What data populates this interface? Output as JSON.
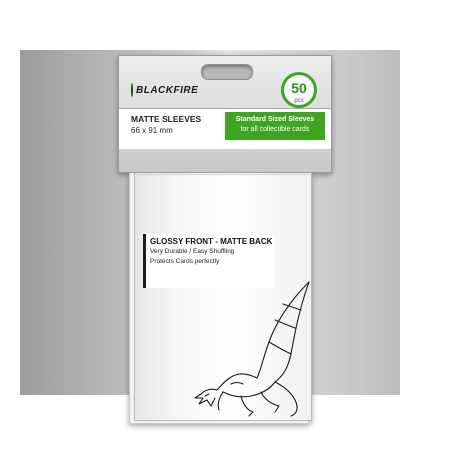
{
  "brand": {
    "name": "BLACKFIRE"
  },
  "badge": {
    "count": "50",
    "unit": "pcs"
  },
  "header": {
    "sleeve_type": "MATTE SLEEVES",
    "sleeve_size": "66 x 91 mm",
    "green_line1": "Standard Sized Sleeves",
    "green_line2": "for all collectible cards"
  },
  "features": {
    "title": "GLOSSY FRONT - MATTE BACK",
    "lines": [
      "Very Durable / Easy Shuffling",
      "Protects Cards perfectly"
    ]
  },
  "colors": {
    "accent": "#3ea421",
    "backdrop": "#c8c8c8"
  },
  "icons": {
    "logo": "blackfire-logo-icon",
    "hang": "hang-hole-icon",
    "art": "dragon-icon"
  }
}
